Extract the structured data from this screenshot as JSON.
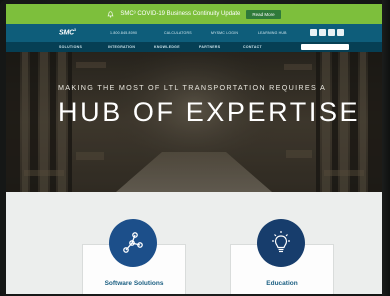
{
  "alert": {
    "text": "SMC³ COVID-19 Business Continuity Update",
    "button": "Read More"
  },
  "header": {
    "logo": "SMC",
    "logo_sup": "3",
    "utility_links": [
      "1.800.845.8090",
      "CALCULATORS",
      "MYSMC LOGIN",
      "LEARNING HUB"
    ],
    "social_icons": [
      "linkedin-icon",
      "facebook-icon",
      "twitter-icon",
      "youtube-icon"
    ]
  },
  "nav": {
    "items": [
      "SOLUTIONS",
      "INTEGRATION",
      "KNOWLEDGE",
      "PARTNERS",
      "CONTACT"
    ]
  },
  "hero": {
    "subtitle": "MAKING THE MOST OF LTL TRANSPORTATION REQUIRES A",
    "title": "HUB OF EXPERTISE"
  },
  "cards": [
    {
      "title": "Software Solutions",
      "icon": "network-nodes-icon",
      "color": "#1c4f8a"
    },
    {
      "title": "Education",
      "icon": "lightbulb-icon",
      "color": "#173d6c"
    }
  ],
  "colors": {
    "alert": "#7dbf3c",
    "header": "#0e5d7a",
    "nav": "#063f54",
    "card_title": "#1b5f82"
  }
}
